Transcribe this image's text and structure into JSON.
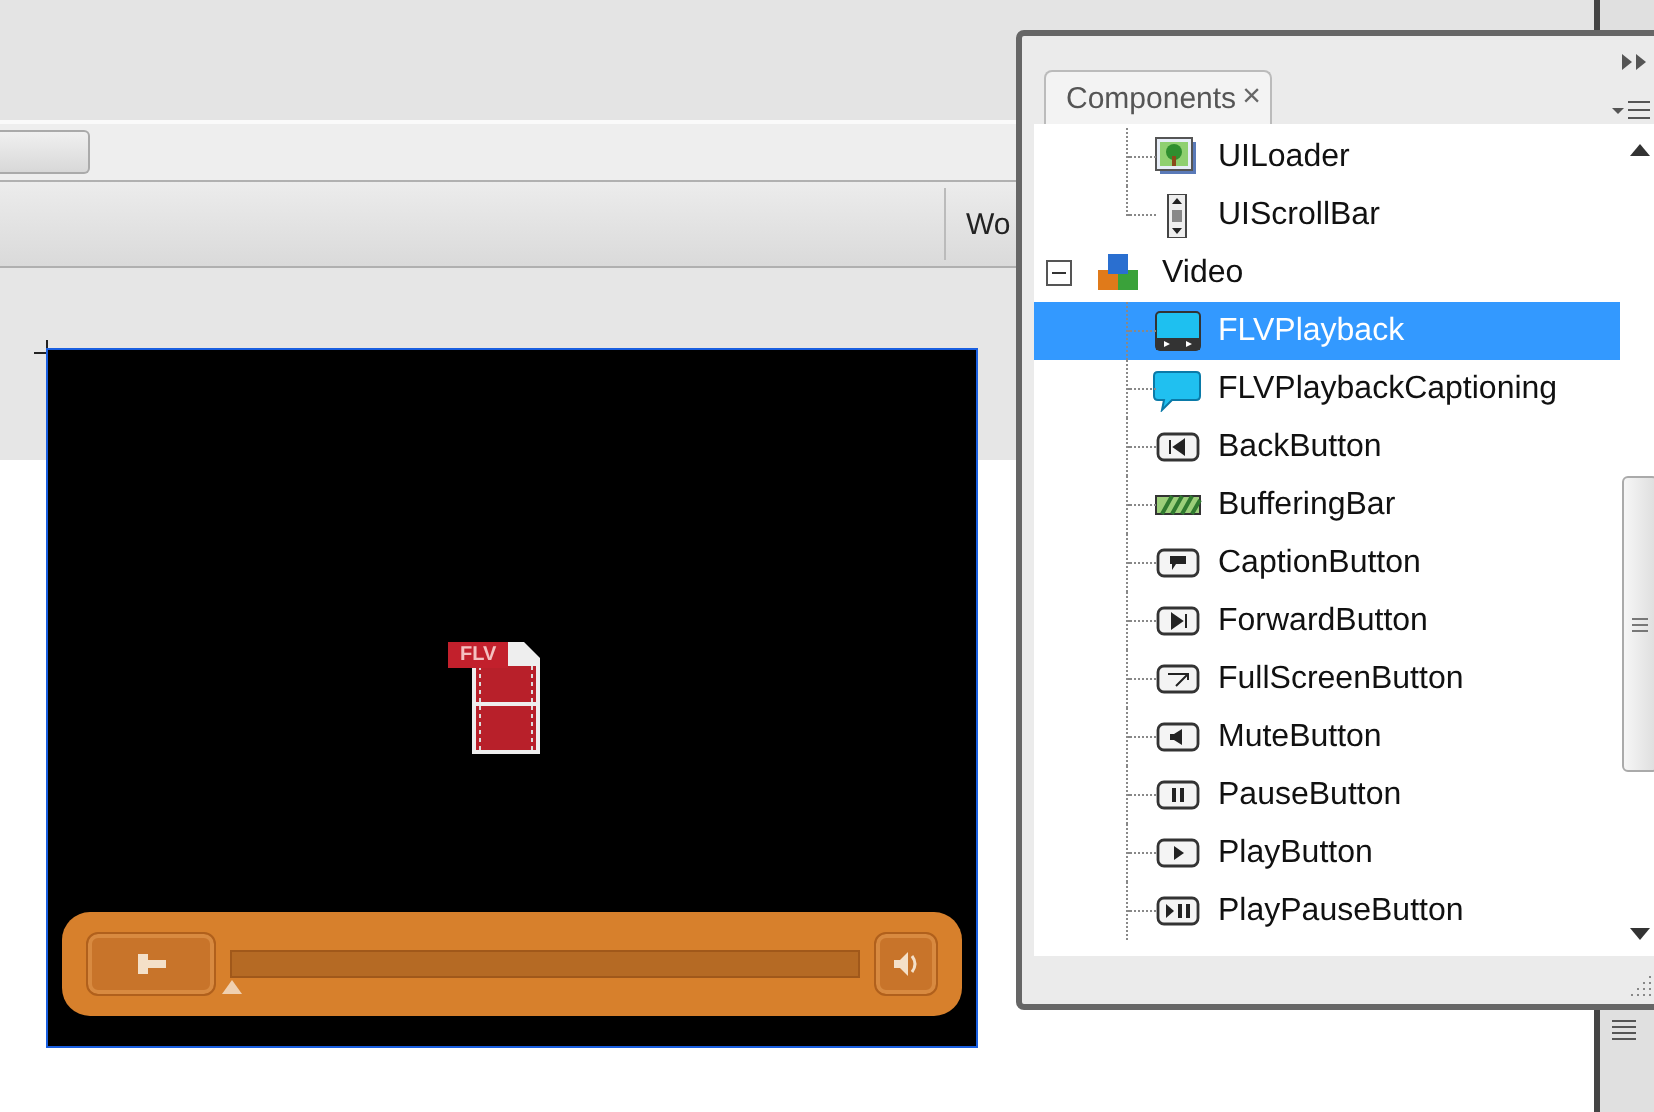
{
  "workspace": {
    "tab_label": "Wo"
  },
  "player": {
    "file_label": "FLV",
    "seek": {
      "level": 0
    }
  },
  "panel": {
    "tab": {
      "label": "Components",
      "close": "×",
      "selected": true
    },
    "tree": [
      {
        "children": [
          {
            "label": "UILoader",
            "kind": "loader",
            "selected": false
          },
          {
            "label": "UIScrollBar",
            "kind": "scrollbar",
            "selected": false
          }
        ]
      },
      {
        "label": "Video",
        "kind": "folder",
        "expanded": true,
        "selected": false,
        "children": [
          {
            "label": "FLVPlayback",
            "kind": "playback",
            "selected": true
          },
          {
            "label": "FLVPlaybackCaptioning",
            "kind": "captioning",
            "selected": false
          },
          {
            "label": "BackButton",
            "kind": "back",
            "selected": false
          },
          {
            "label": "BufferingBar",
            "kind": "buffering",
            "selected": false
          },
          {
            "label": "CaptionButton",
            "kind": "caption",
            "selected": false
          },
          {
            "label": "ForwardButton",
            "kind": "forward",
            "selected": false
          },
          {
            "label": "FullScreenButton",
            "kind": "fullscreen",
            "selected": false
          },
          {
            "label": "MuteButton",
            "kind": "mute",
            "selected": false
          },
          {
            "label": "PauseButton",
            "kind": "pause",
            "selected": false
          },
          {
            "label": "PlayButton",
            "kind": "play",
            "selected": false
          },
          {
            "label": "PlayPauseButton",
            "kind": "playpause",
            "selected": false
          }
        ]
      }
    ]
  }
}
